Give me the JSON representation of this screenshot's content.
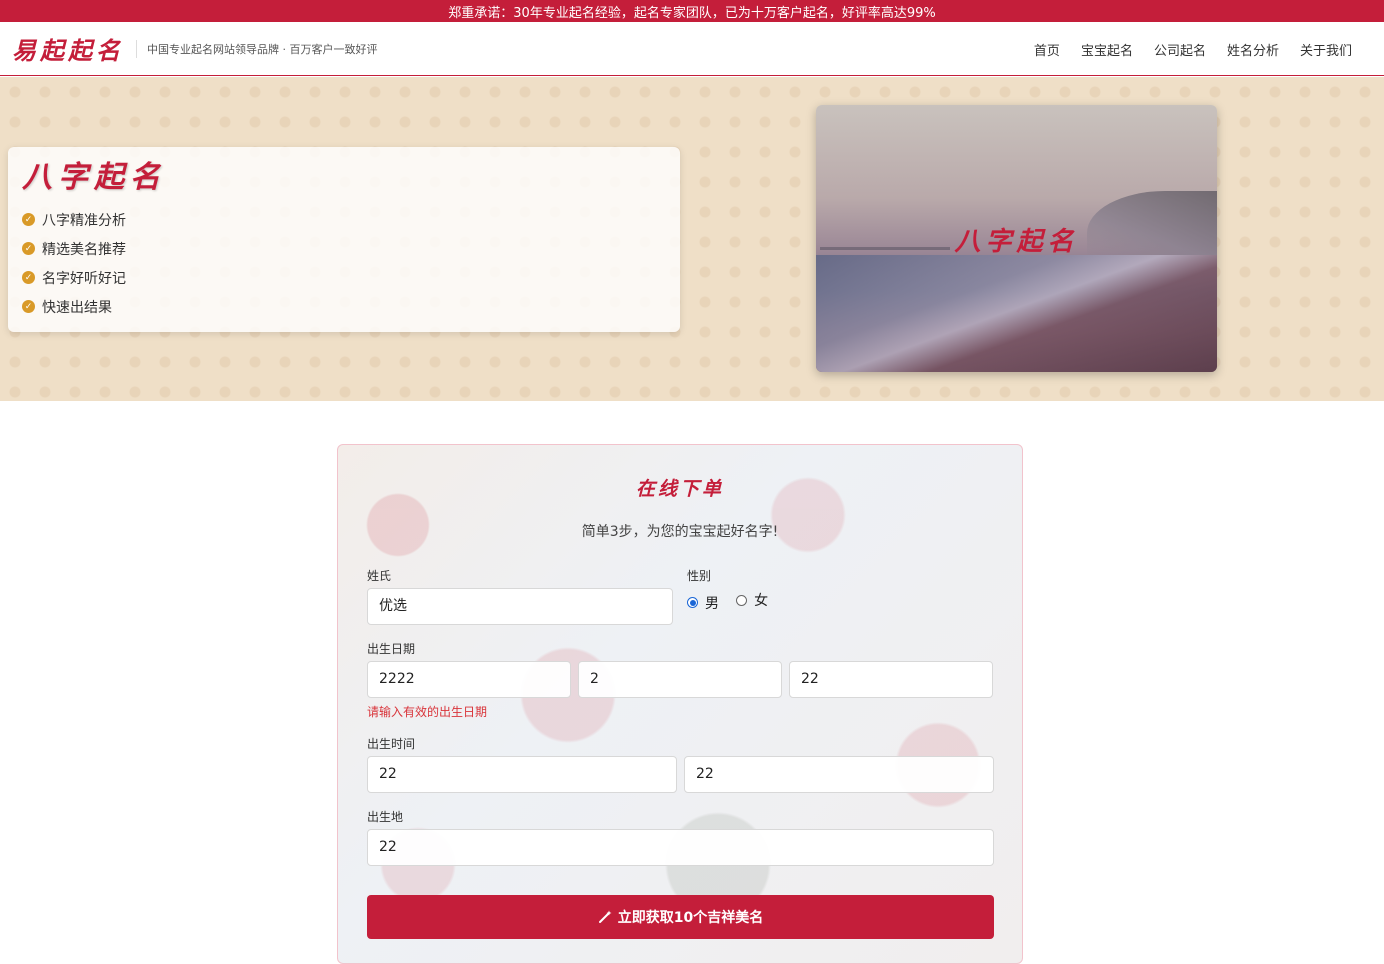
{
  "topbar": {
    "text": "郑重承诺：30年专业起名经验，起名专家团队，已为十万客户起名，好评率高达99%"
  },
  "header": {
    "logo": "易起起名",
    "slogan": "中国专业起名网站领导品牌 · 百万客户一致好评",
    "nav": [
      "首页",
      "宝宝起名",
      "公司起名",
      "姓名分析",
      "关于我们"
    ]
  },
  "hero": {
    "title": "八字起名",
    "features": [
      "八字精准分析",
      "精选美名推荐",
      "名字好听好记",
      "快速出结果"
    ],
    "image_title": "八字起名"
  },
  "order": {
    "title": "在线下单",
    "subtitle": "简单3步，为您的宝宝起好名字!",
    "surname_label": "姓氏",
    "surname_value": "优选",
    "gender_label": "性别",
    "gender_options": [
      "男",
      "女"
    ],
    "gender_selected": "男",
    "birthdate_label": "出生日期",
    "birth_year": "2222",
    "birth_month": "2",
    "birth_day": "22",
    "birthdate_error": "请输入有效的出生日期",
    "birthtime_label": "出生时间",
    "birth_hour": "22",
    "birth_minute": "22",
    "birthplace_label": "出生地",
    "birthplace_value": "22",
    "submit_label": "立即获取10个吉祥美名"
  },
  "colors": {
    "brand": "#c41e3a",
    "check": "#d99a28",
    "radio": "#1a66d6"
  },
  "icons": {
    "feature": "check-circle-icon",
    "submit": "magic-wand-icon"
  }
}
